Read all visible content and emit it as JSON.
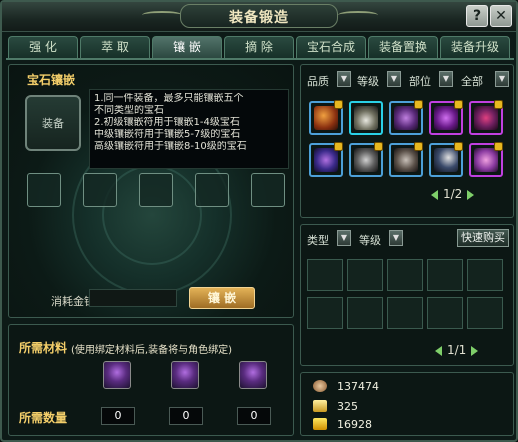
{
  "window": {
    "title": "装备锻造",
    "help_label": "?",
    "close_label": "✕"
  },
  "tabs": [
    "强 化",
    "萃 取",
    "镶 嵌",
    "摘 除",
    "宝石合成",
    "装备置换",
    "装备升级"
  ],
  "active_tab": 2,
  "inlay": {
    "section_title": "宝石镶嵌",
    "equip_slot_label": "装备",
    "info_lines": [
      "1.同一件装备，最多只能镶嵌五个",
      "不同类型的宝石",
      "2.初级镶嵌符用于镶嵌1-4级宝石",
      "中级镶嵌符用于镶嵌5-7级的宝石",
      "高级镶嵌符用于镶嵌8-10级的宝石"
    ],
    "cost_label": "消耗金钱:",
    "cost_value": "",
    "inlay_button": "镶 嵌"
  },
  "materials": {
    "title": "所需材料",
    "note": "(使用绑定材料后,装备将与角色绑定)",
    "quantity_label": "所需数量",
    "counts": [
      "0",
      "0",
      "0"
    ]
  },
  "equipment_list": {
    "filters": [
      "品质",
      "等级",
      "部位",
      "全部"
    ],
    "pager": "1/2",
    "items": [
      {
        "name": "fan-weapon-icon",
        "rarity": "blue"
      },
      {
        "name": "claw-necklace-icon",
        "rarity": "cyan"
      },
      {
        "name": "purple-boots-icon",
        "rarity": "blue"
      },
      {
        "name": "purple-robe-icon",
        "rarity": "purple"
      },
      {
        "name": "dragon-shoulder-icon",
        "rarity": "purple"
      },
      {
        "name": "blue-armor-icon",
        "rarity": "blue"
      },
      {
        "name": "chain-whip-icon",
        "rarity": "blue"
      },
      {
        "name": "gauntlet-icon",
        "rarity": "blue"
      },
      {
        "name": "pen-weapon-icon",
        "rarity": "blue"
      },
      {
        "name": "pink-costume-icon",
        "rarity": "purple"
      }
    ]
  },
  "gem_list": {
    "filters": [
      "类型",
      "等级"
    ],
    "quick_buy": "快速购买",
    "pager": "1/1"
  },
  "currency": {
    "copper": "137474",
    "bound_gold": "325",
    "gold": "16928"
  },
  "colors": {
    "accent_gold": "#f4cf6a",
    "rarity_blue": "#4da0d8",
    "rarity_purple": "#c040e0",
    "rarity_cyan": "#2ad0e6"
  }
}
